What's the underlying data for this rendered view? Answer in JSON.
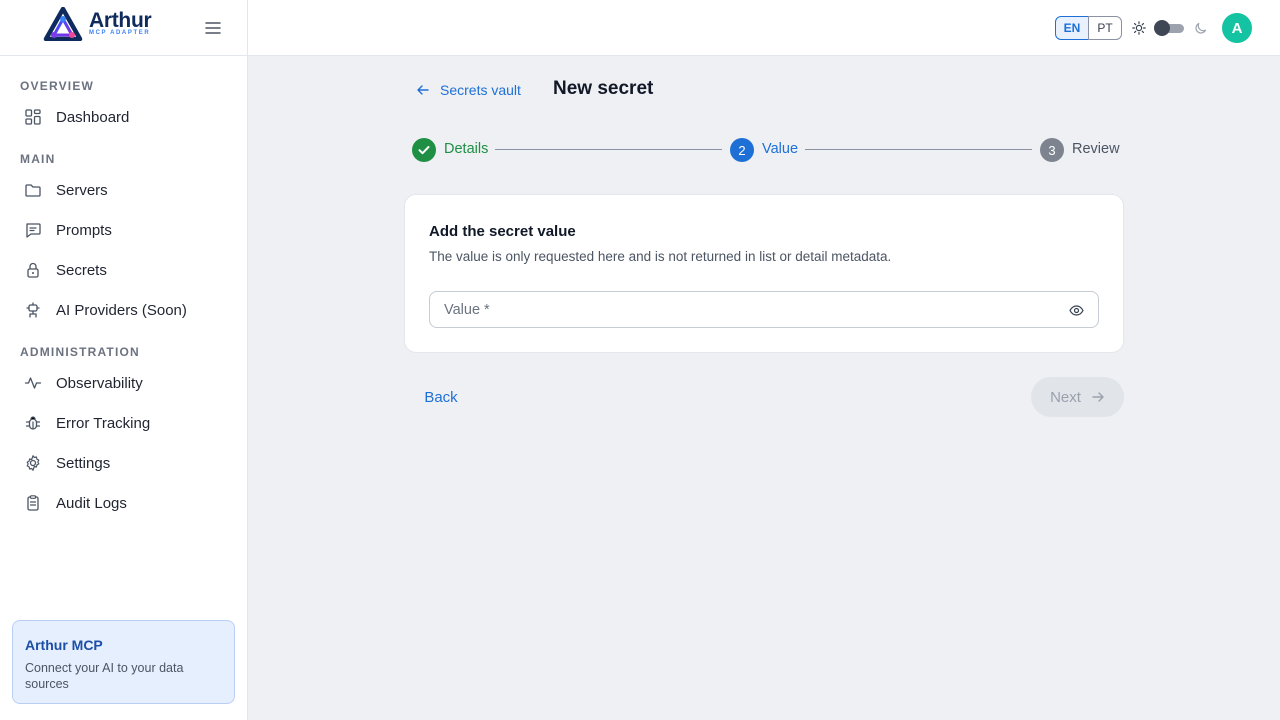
{
  "brand": {
    "name": "Arthur",
    "subtitle": "MCP ADAPTER",
    "logo_icon": "arthur-logo-icon",
    "menu_icon": "hamburger-menu-icon"
  },
  "sidebar": {
    "sections": [
      {
        "label": "OVERVIEW",
        "items": [
          {
            "label": "Dashboard",
            "icon": "dashboard-grid-icon"
          }
        ]
      },
      {
        "label": "MAIN",
        "items": [
          {
            "label": "Servers",
            "icon": "folder-icon"
          },
          {
            "label": "Prompts",
            "icon": "message-square-icon"
          },
          {
            "label": "Secrets",
            "icon": "lock-icon"
          },
          {
            "label": "AI Providers (Soon)",
            "icon": "robot-icon"
          }
        ]
      },
      {
        "label": "ADMINISTRATION",
        "items": [
          {
            "label": "Observability",
            "icon": "activity-pulse-icon"
          },
          {
            "label": "Error Tracking",
            "icon": "bug-icon"
          },
          {
            "label": "Settings",
            "icon": "gear-icon"
          },
          {
            "label": "Audit Logs",
            "icon": "clipboard-icon"
          }
        ]
      }
    ],
    "promo": {
      "title": "Arthur MCP",
      "description": "Connect your AI to your data sources"
    }
  },
  "topbar": {
    "languages": [
      "EN",
      "PT"
    ],
    "active_language": "EN",
    "theme": "light",
    "avatar_initial": "A"
  },
  "page": {
    "back_link": "Secrets vault",
    "title": "New secret"
  },
  "stepper": {
    "steps": [
      {
        "number": "1",
        "label": "Details",
        "status": "completed"
      },
      {
        "number": "2",
        "label": "Value",
        "status": "active"
      },
      {
        "number": "3",
        "label": "Review",
        "status": "pending"
      }
    ]
  },
  "card": {
    "title": "Add the secret value",
    "description": "The value is only requested here and is not returned in list or detail metadata.",
    "input": {
      "placeholder": "Value *",
      "value": ""
    }
  },
  "actions": {
    "back_label": "Back",
    "next_label": "Next",
    "next_enabled": false
  },
  "colors": {
    "primary": "#1e70d6",
    "success": "#1e8f43",
    "avatar": "#14c3a2"
  }
}
